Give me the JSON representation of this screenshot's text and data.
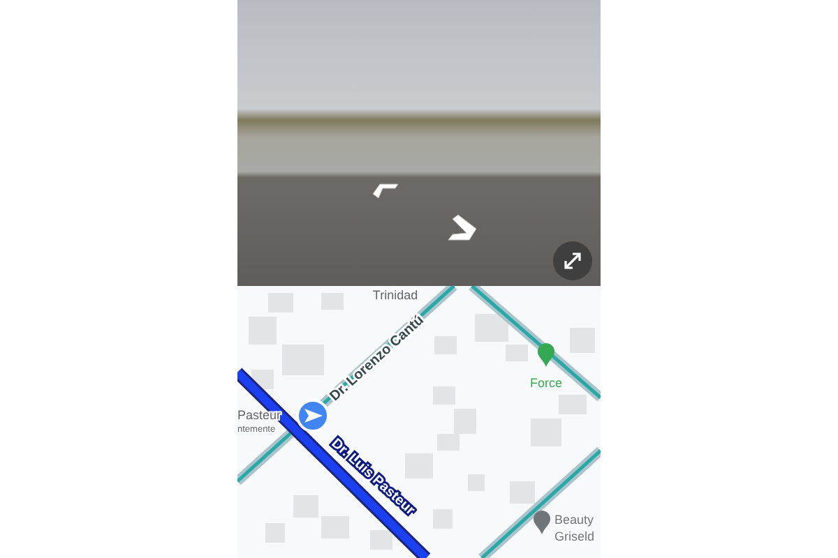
{
  "map": {
    "streets": [
      {
        "name": "Dr. Lorenzo Cantú",
        "highlighted": false
      },
      {
        "name": "Dr. Luis Pasteur",
        "highlighted": true
      }
    ],
    "labels": [
      {
        "text": "Trinidad",
        "kind": "area"
      },
      {
        "text": "Pasteur",
        "kind": "area"
      },
      {
        "text": "ntemente",
        "kind": "area"
      }
    ],
    "places": [
      {
        "name": "Force",
        "color": "#34a853"
      },
      {
        "name": "Beauty",
        "sub": "Griseld",
        "color": "#70757a"
      }
    ]
  }
}
